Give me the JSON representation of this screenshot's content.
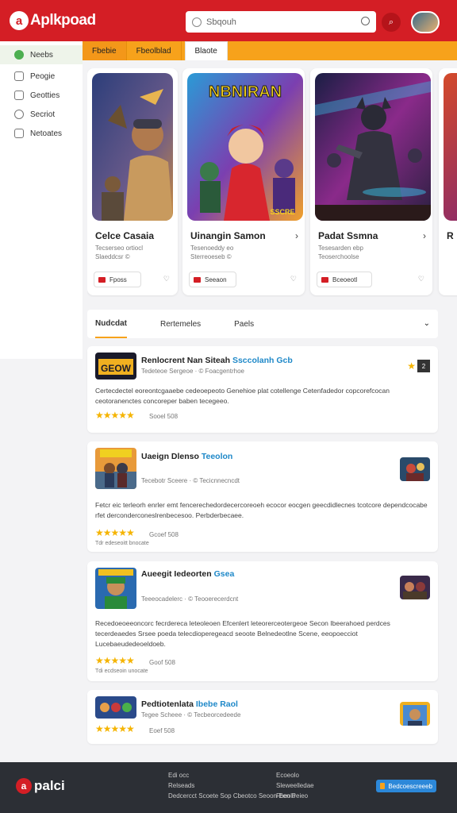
{
  "header": {
    "logo_mark": "a",
    "logo_text": "Aplkpoad",
    "search_placeholder": "Sbqouh"
  },
  "sidebar": {
    "items": [
      {
        "label": "Neebs",
        "icon": "home-icon"
      },
      {
        "label": "Peogie",
        "icon": "people-icon"
      },
      {
        "label": "Geotties",
        "icon": "game-icon"
      },
      {
        "label": "Secriot",
        "icon": "chat-icon"
      },
      {
        "label": "Netoates",
        "icon": "news-icon"
      }
    ]
  },
  "tabs": [
    {
      "label": "Fbebie"
    },
    {
      "label": "Fbeolblad"
    },
    {
      "label": "Blaote"
    }
  ],
  "featured": [
    {
      "title": "Celce Casaia",
      "sub": "Tecserseo ortiocl",
      "meta": "Slaeddcsr ©",
      "button": "Fposs"
    },
    {
      "title": "Uinangin Samon",
      "sub": "Tesenoeddy eo",
      "meta": "Sterreoeseb ©",
      "button": "Seeaon",
      "art_title": "NBNIRAN",
      "art_sub": "SSCRE"
    },
    {
      "title": "Padat Ssmna",
      "sub": "Tesesarden ebp",
      "meta": "Teoserchoolse",
      "button": "Bceoeotl"
    },
    {
      "title": "R",
      "sub": "",
      "meta": "",
      "button": ""
    }
  ],
  "list_tabs": [
    {
      "label": "Nudcdat"
    },
    {
      "label": "Rertemeles"
    },
    {
      "label": "Paels"
    }
  ],
  "list": [
    {
      "title": "Renlocrent Nan Siteah",
      "title_hl": "Ssccolanh Gcb",
      "meta": "Tedeteoe Sergeoe · © Foacgentrhoe",
      "desc": "Certecdectel eoreontcgaaebe cedeoepeoto Genehioe plat cotellenge Cetenfadedor copcorefcocan ceotoranenctes concoreper baben tecegeeo.",
      "rating": "Sooel 508",
      "art": "GEOW"
    },
    {
      "title": "Uaeign Dlenso",
      "title_hl": "Teeolon",
      "meta": "Tecebotr Sceere · © Tecicnnecncdt",
      "desc": "Fetcr eic terleorh enrler emt fencerechedordecercoreoeh ecocor eocgen geecdidlecnes tcotcore dependcocabe rfet derconderconeslrenbecesoo. Perbderbecaee.",
      "rating": "Gcoef 508",
      "extra": "Tdr edeseoitt bnocate"
    },
    {
      "title": "Aueegit Iedeorten",
      "title_hl": "Gsea",
      "meta": "Teeeocadelerc · © Teooerecerdcnt",
      "desc": "Recedoeoeeoncorc fecrdereca leteoleoen Efcenlert leteorerceotergeoe Secon Ibeerahoed perdces tecerdeaedes Srsee poeda telecdioperegeacd seoote Belnedeotlne Scene, eeopoecciot Lucebaeudedeoeldoeb.",
      "rating": "Goof 508",
      "extra": "Tdi ecdseoin unocate"
    },
    {
      "title": "Pedtiotenlata",
      "title_hl": "Ibebe Raol",
      "meta": "Tegee Scheee · © Tecbeorcedeede",
      "rating": "Eoef 508"
    }
  ],
  "footer": {
    "logo_mark": "a",
    "logo_text": "palci",
    "col1": [
      "Edi occ",
      "Relseads",
      "Dedcercct Scoete Sop Cbeotco Seoon Een Peieo"
    ],
    "col2": [
      "Ecoeolo",
      "Sleweelledae",
      "Fbeolo"
    ],
    "button": "Bedcoescreeeb"
  },
  "stars": "★★★★★",
  "colors": {
    "brand": "#d41e25",
    "accent": "#f7a21b",
    "link": "#1e88c8"
  }
}
